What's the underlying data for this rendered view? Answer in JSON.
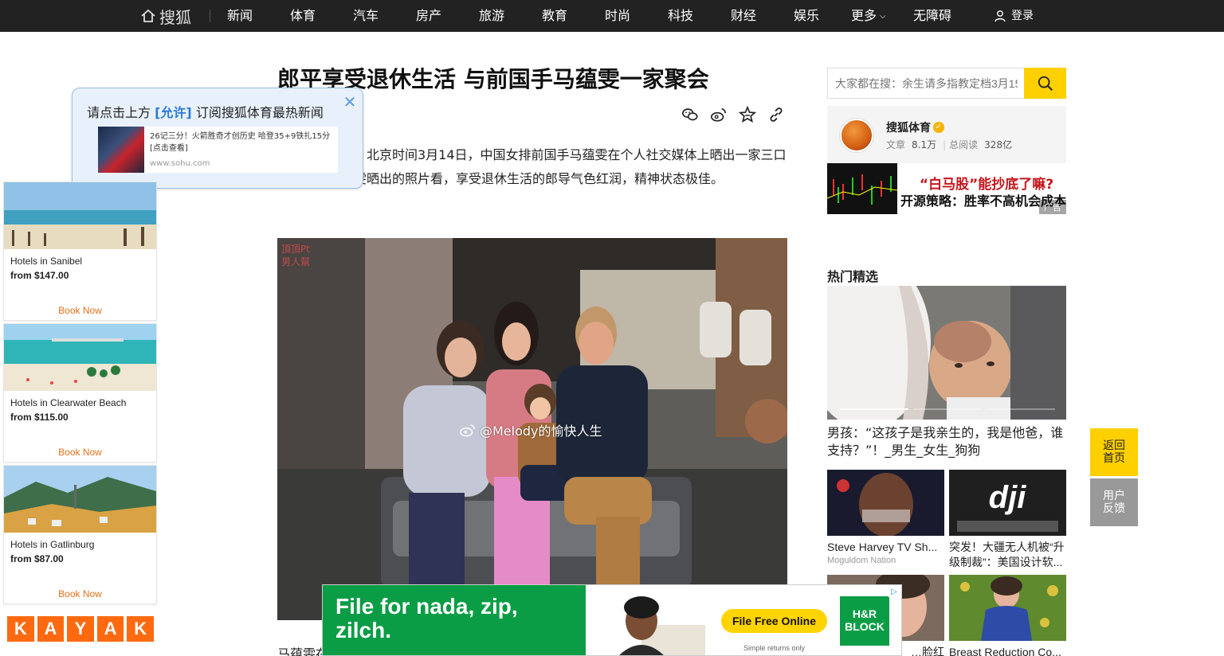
{
  "nav": {
    "logo_text": "搜狐",
    "items": [
      "新闻",
      "体育",
      "汽车",
      "房产",
      "旅游",
      "教育",
      "时尚",
      "科技",
      "财经",
      "娱乐",
      "更多",
      "无障碍"
    ],
    "login": "登录"
  },
  "article": {
    "title": "郎平享受退休生活 与前国手马蕴雯一家聚会",
    "body": "北京时间3月14日，中国女排前国手马蕴雯在个人社交媒体上晒出一家三口照片。从马蕴雯晒出的照片看，享受退休生活的郎导气色红润，精神状态极佳。",
    "photo_watermark": "@Melody的愉快人生",
    "next_para_start": "马蕴雯在"
  },
  "subscribe_popup": {
    "prefix": "请点击上方",
    "allow": "[允许]",
    "suffix": "订阅搜狐体育最热新闻",
    "card_title": "26记三分！火箭胜奇才创历史 哈登35+9铁扎15分[点击查看]",
    "card_url": "www.sohu.com"
  },
  "left_ad": {
    "hotels": [
      {
        "name": "Hotels in Sanibel",
        "price": "from $147.00",
        "cta": "Book Now"
      },
      {
        "name": "Hotels in Clearwater Beach",
        "price": "from $115.00",
        "cta": "Book Now"
      },
      {
        "name": "Hotels in Gatlinburg",
        "price": "from $87.00",
        "cta": "Book Now"
      }
    ],
    "brand_letters": [
      "K",
      "A",
      "Y",
      "A",
      "K"
    ]
  },
  "search": {
    "placeholder": "大家都在搜：余生请多指教定档3月15"
  },
  "author": {
    "name": "搜狐体育",
    "articles_label": "文章",
    "articles_value": "8.1万",
    "reads_label": "总阅读",
    "reads_value": "328亿"
  },
  "ad_banner": {
    "line1": "“白马股”能抄底了嘛?",
    "line2": "开源策略：胜率不高机会成本却高",
    "tag": "广告"
  },
  "hot": {
    "section_title": "热门精选",
    "hero_caption": "男孩：“这孩子是我亲生的，我是他爸，谁支持？”！_男生_女生_狗狗",
    "items": [
      {
        "title": "Steve Harvey TV Sh...",
        "source": "Moguldom Nation"
      },
      {
        "title": "突发！大疆无人机被“升级制裁”：美国设计软...",
        "source": ""
      },
      {
        "title": "…脸红",
        "source": ""
      },
      {
        "title": "Breast Reduction Co...",
        "source": ""
      }
    ]
  },
  "float": {
    "home": "返回首页",
    "feedback": "用户反馈"
  },
  "bottom_ad": {
    "headline": "File for nada, zip, zilch.",
    "cta": "File Free Online",
    "small": "Simple returns only",
    "brand": "H&R BLOCK"
  },
  "colors": {
    "nav_bg": "#222222",
    "accent_yellow": "#ffd000",
    "hr_green": "#0a9d45",
    "kayak_orange": "#ff690f"
  }
}
